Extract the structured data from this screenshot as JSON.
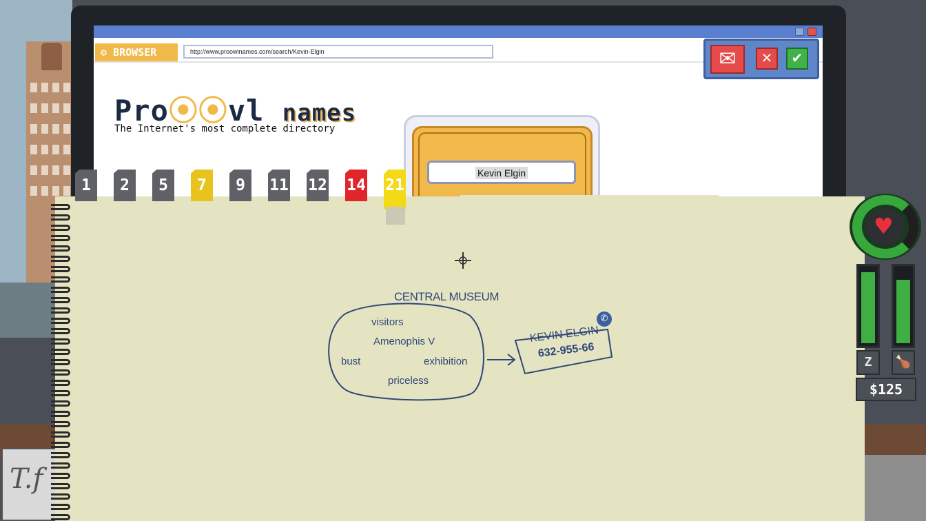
{
  "browser": {
    "label": "BROWSER",
    "url": "http://www.proowlnames.com/search/Kevin-Elgin",
    "site_logo_prefix": "Pro",
    "site_logo_mid": "vl",
    "site_logo_suffix": "names",
    "tagline": "The Internet's most complete directory",
    "search_result_name": "Kevin Elgin"
  },
  "mail_panel": {
    "mail_icon": "envelope-icon",
    "reject_icon": "x-icon",
    "accept_icon": "check-icon"
  },
  "tabs": [
    {
      "label": "1",
      "color": "gray"
    },
    {
      "label": "2",
      "color": "gray"
    },
    {
      "label": "5",
      "color": "gray"
    },
    {
      "label": "7",
      "color": "yellow"
    },
    {
      "label": "9",
      "color": "gray"
    },
    {
      "label": "11",
      "color": "gray"
    },
    {
      "label": "12",
      "color": "gray"
    },
    {
      "label": "14",
      "color": "red"
    },
    {
      "label": "21",
      "color": "active"
    }
  ],
  "notebook": {
    "heading": "CENTRAL MUSEUM",
    "bubble_words": [
      "visitors",
      "Amenophis V",
      "bust",
      "exhibition",
      "priceless"
    ],
    "contact_name": "KEVIN ELGIN",
    "contact_phone": "632-955-66",
    "phone_icon": "phone-icon"
  },
  "hud": {
    "money": "$125",
    "heart_icon": "heart-icon",
    "sleep_label": "Z",
    "food_icon": "drumstick-icon",
    "sleep_level": 0.95,
    "food_level": 0.85
  },
  "colors": {
    "accent_yellow": "#f1b84a",
    "ink_blue": "#2f4778",
    "tab_red": "#e0262b",
    "hud_green": "#3fae43"
  }
}
